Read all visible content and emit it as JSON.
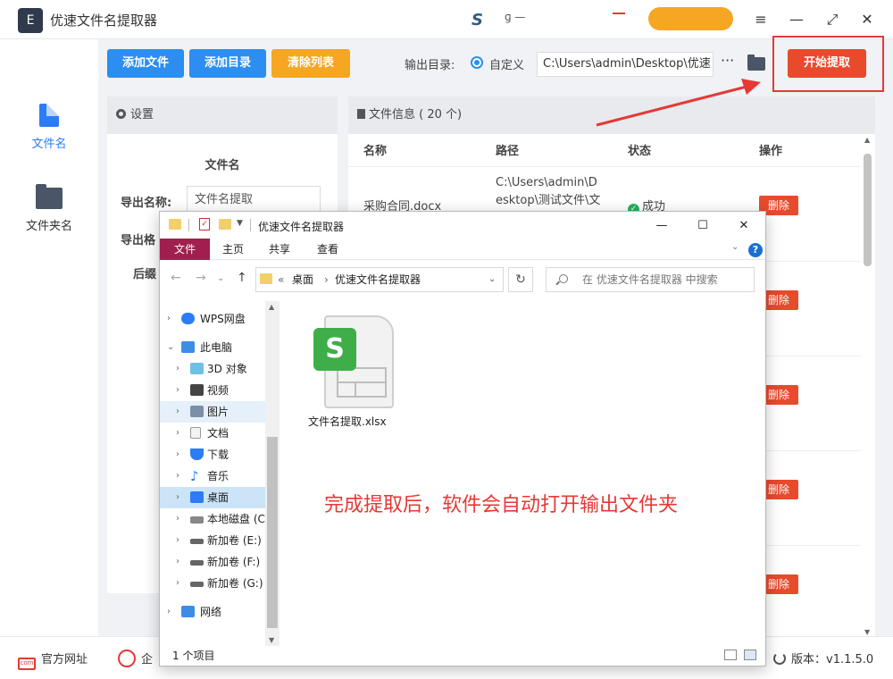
{
  "app": {
    "title": "优速文件名提取器",
    "logo_glyph": "E",
    "window_controls": {
      "menu": "≡",
      "minimize": "—",
      "maximize": "⤢",
      "close": "✕"
    }
  },
  "sidebar": {
    "items": [
      {
        "label": "文件名",
        "icon": "document-icon",
        "active": true
      },
      {
        "label": "文件夹名",
        "icon": "folder-icon",
        "active": false
      }
    ]
  },
  "toolbar": {
    "add_file": "添加文件",
    "add_dir": "添加目录",
    "clear_list": "清除列表",
    "output_dir_label": "输出目录:",
    "custom_label": "自定义",
    "output_path": "C:\\Users\\admin\\Desktop\\优速",
    "more": "···",
    "start": "开始提取"
  },
  "settings": {
    "header": "设置",
    "section": "文件名",
    "export_name_label": "导出名称:",
    "export_name_value": "文件名提取",
    "export_format_label": "导出格",
    "suffix_label": "后缀"
  },
  "file_info": {
    "header": "文件信息 ( 20 个)",
    "columns": [
      "名称",
      "路径",
      "状态",
      "操作"
    ],
    "rows": [
      {
        "name": "采购合同.docx",
        "path": "C:\\Users\\admin\\Desktop\\测试文件\\文件名提取器\\",
        "status": "成功",
        "action": "删除"
      },
      {
        "name": "",
        "path": "",
        "status": "",
        "action": "删除"
      },
      {
        "name": "",
        "path": "",
        "status": "",
        "action": "删除"
      },
      {
        "name": "",
        "path": "",
        "status": "",
        "action": "删除"
      },
      {
        "name": "",
        "path": "",
        "status": "",
        "action": "删除"
      }
    ]
  },
  "footer": {
    "website": "官方网址",
    "qq_partial": "企",
    "version": "版本：v1.1.5.0"
  },
  "explorer": {
    "title": "优速文件名提取器",
    "ribbon_tabs": [
      "文件",
      "主页",
      "共享",
      "查看"
    ],
    "address": {
      "prefix": "«",
      "crumbs": [
        "桌面",
        "优速文件名提取器"
      ]
    },
    "search_placeholder": "在 优速文件名提取器 中搜索",
    "tree": [
      {
        "label": "WPS网盘",
        "indent": 0,
        "arrow": "›",
        "icon": "cloud-icon"
      },
      {
        "label": "此电脑",
        "indent": 0,
        "arrow": "⌄",
        "icon": "computer-icon"
      },
      {
        "label": "3D 对象",
        "indent": 1,
        "arrow": "›",
        "icon": "3d-objects-icon"
      },
      {
        "label": "视频",
        "indent": 1,
        "arrow": "›",
        "icon": "video-icon"
      },
      {
        "label": "图片",
        "indent": 1,
        "arrow": "›",
        "icon": "pictures-icon"
      },
      {
        "label": "文档",
        "indent": 1,
        "arrow": "›",
        "icon": "documents-icon"
      },
      {
        "label": "下载",
        "indent": 1,
        "arrow": "›",
        "icon": "download-icon"
      },
      {
        "label": "音乐",
        "indent": 1,
        "arrow": "›",
        "icon": "music-icon"
      },
      {
        "label": "桌面",
        "indent": 1,
        "arrow": "›",
        "icon": "desktop-icon"
      },
      {
        "label": "本地磁盘 (C",
        "indent": 1,
        "arrow": "›",
        "icon": "drive-c-icon"
      },
      {
        "label": "新加卷 (E:)",
        "indent": 1,
        "arrow": "›",
        "icon": "drive-icon"
      },
      {
        "label": "新加卷 (F:)",
        "indent": 1,
        "arrow": "›",
        "icon": "drive-icon"
      },
      {
        "label": "新加卷 (G:)",
        "indent": 1,
        "arrow": "›",
        "icon": "drive-icon"
      },
      {
        "label": "网络",
        "indent": 0,
        "arrow": "›",
        "icon": "network-icon"
      }
    ],
    "file": {
      "name": "文件名提取.xlsx",
      "badge": "S"
    },
    "annotation": "完成提取后，软件会自动打开输出文件夹",
    "status": "1 个项目"
  },
  "colors": {
    "accent_blue": "#2b8ef0",
    "accent_orange": "#f5a623",
    "accent_red": "#e84a2c",
    "ribbon_active": "#a01f4e",
    "wps_green": "#3fae49"
  }
}
